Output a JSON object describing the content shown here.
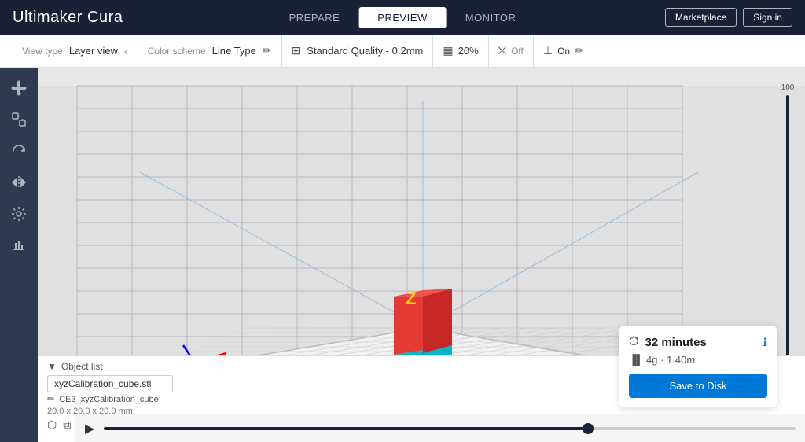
{
  "header": {
    "logo_light": "Ultimaker",
    "logo_bold": "Cura",
    "tabs": [
      {
        "id": "prepare",
        "label": "PREPARE",
        "active": false
      },
      {
        "id": "preview",
        "label": "PREVIEW",
        "active": true
      },
      {
        "id": "monitor",
        "label": "MONITOR",
        "active": false
      }
    ],
    "marketplace_label": "Marketplace",
    "signin_label": "Sign in"
  },
  "toolbar": {
    "view_type_label": "View type",
    "view_type_value": "Layer view",
    "color_scheme_label": "Color scheme",
    "color_scheme_value": "Line Type",
    "quality_label": "Standard Quality - 0.2mm",
    "infill_pct": "20%",
    "support_label": "Off",
    "adhesion_label": "On"
  },
  "sidebar": {
    "buttons": [
      {
        "id": "move",
        "icon": "⊕",
        "label": "move-icon"
      },
      {
        "id": "scale",
        "icon": "⛶",
        "label": "scale-icon"
      },
      {
        "id": "rotate",
        "icon": "↻",
        "label": "rotate-icon"
      },
      {
        "id": "mirror",
        "icon": "⇔",
        "label": "mirror-icon"
      },
      {
        "id": "settings",
        "icon": "≡",
        "label": "settings-icon"
      },
      {
        "id": "supports",
        "icon": "⊞",
        "label": "supports-icon"
      }
    ]
  },
  "layer_slider": {
    "top_label": "100"
  },
  "object_list": {
    "header": "Object list",
    "file_name": "xyzCalibration_cube.stl",
    "model_name": "CE3_xyzCalibration_cube",
    "dimensions": "20.0 x 20.0 x 20.0 mm"
  },
  "info_panel": {
    "time_icon": "⏱",
    "time_text": "32 minutes",
    "material_text": "4g · 1.40m",
    "info_icon": "ℹ",
    "save_label": "Save to Disk"
  },
  "playback": {
    "play_icon": "▶",
    "progress": 70
  }
}
